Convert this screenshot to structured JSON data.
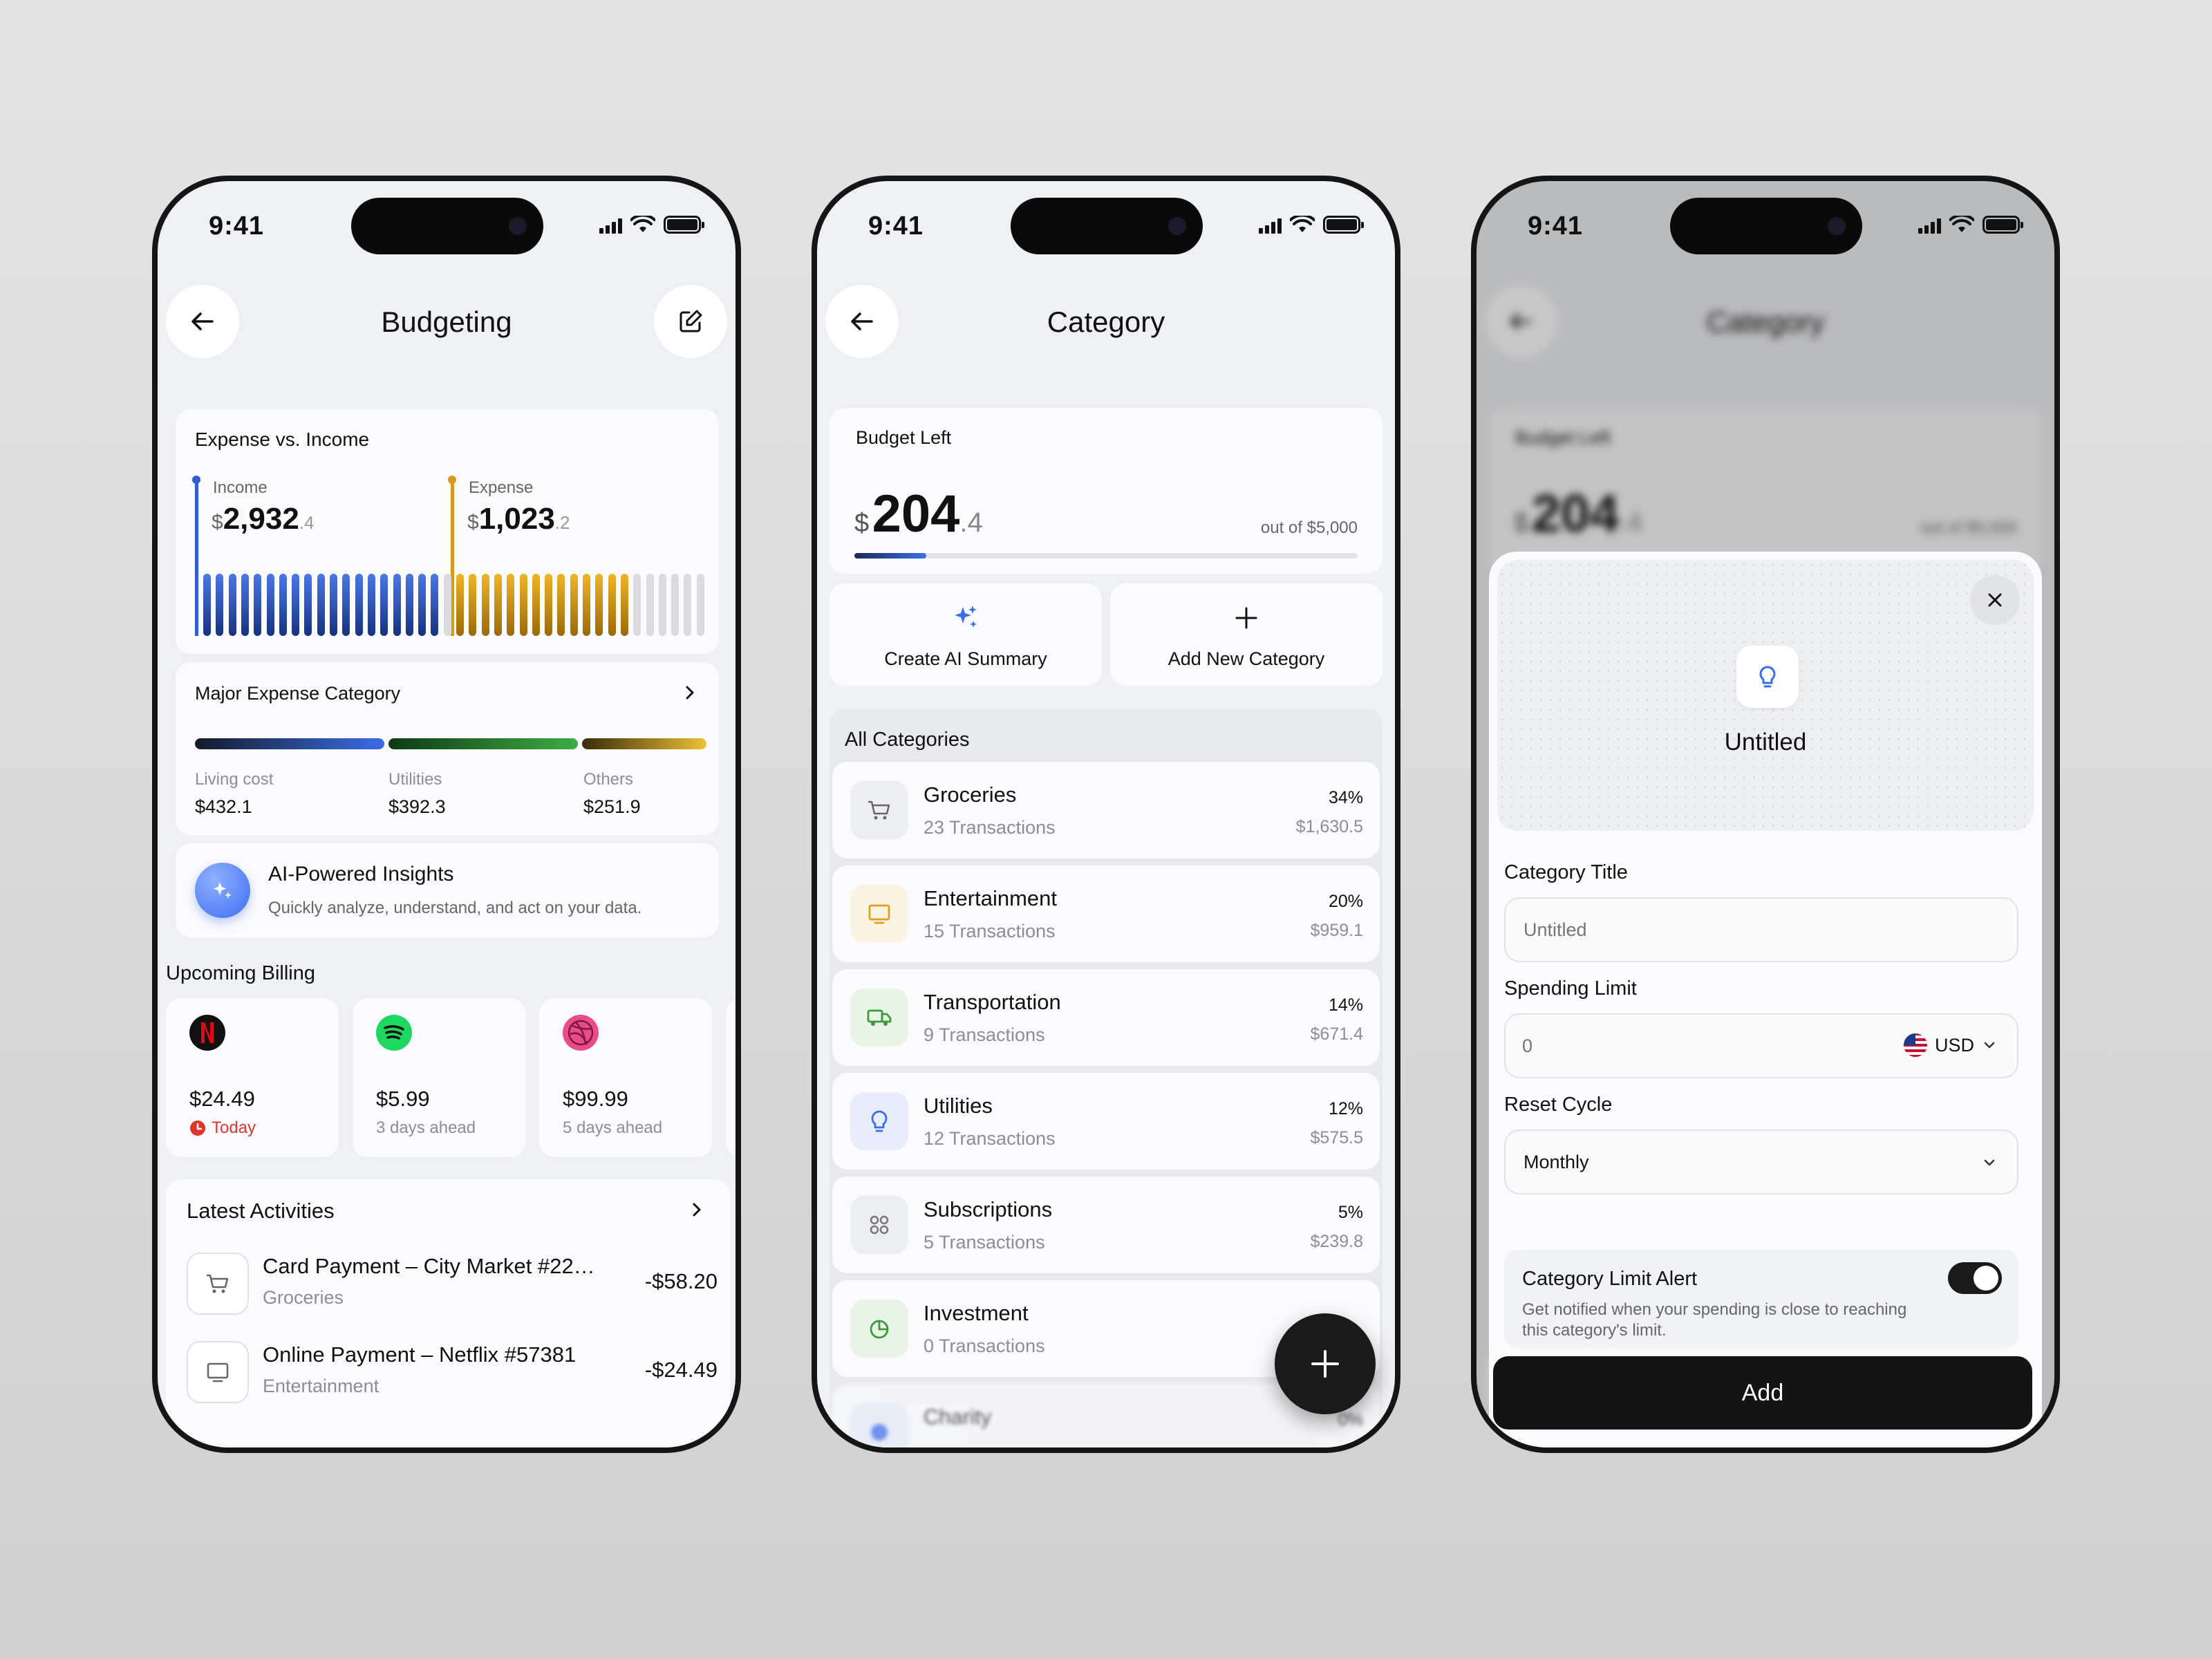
{
  "status_time": "9:41",
  "budgeting": {
    "title": "Budgeting",
    "expense_income": {
      "title": "Expense vs. Income",
      "income_label": "Income",
      "income_currency": "$",
      "income_value": "2,932",
      "income_decimal": ".4",
      "expense_label": "Expense",
      "expense_currency": "$",
      "expense_value": "1,023",
      "expense_decimal": ".2"
    },
    "major": {
      "title": "Major Expense Category",
      "items": [
        {
          "label": "Living cost",
          "value": "$432.1"
        },
        {
          "label": "Utilities",
          "value": "$392.3"
        },
        {
          "label": "Others",
          "value": "$251.9"
        }
      ]
    },
    "ai": {
      "title": "AI-Powered Insights",
      "desc": "Quickly analyze, understand, and act on your data."
    },
    "upcoming": {
      "title": "Upcoming Billing",
      "items": [
        {
          "amount": "$24.49",
          "when": "Today"
        },
        {
          "amount": "$5.99",
          "when": "3 days ahead"
        },
        {
          "amount": "$99.99",
          "when": "5 days ahead"
        }
      ]
    },
    "activities": {
      "title": "Latest Activities",
      "items": [
        {
          "title": "Card Payment – City Market #22…",
          "category": "Groceries",
          "amount": "-$58.20"
        },
        {
          "title": "Online Payment – Netflix #57381",
          "category": "Entertainment",
          "amount": "-$24.49"
        }
      ]
    }
  },
  "category": {
    "title": "Category",
    "budget": {
      "label": "Budget Left",
      "currency": "$",
      "value": "204",
      "decimal": ".4",
      "out_of": "out of $5,000",
      "progress": 0.041
    },
    "actions": {
      "ai": "Create AI Summary",
      "add": "Add New Category"
    },
    "all_label": "All Categories",
    "items": [
      {
        "name": "Groceries",
        "tx": "23 Transactions",
        "pct": "34%",
        "amount": "$1,630.5",
        "icon": "cart-icon"
      },
      {
        "name": "Entertainment",
        "tx": "15 Transactions",
        "pct": "20%",
        "amount": "$959.1",
        "icon": "monitor-icon"
      },
      {
        "name": "Transportation",
        "tx": "9 Transactions",
        "pct": "14%",
        "amount": "$671.4",
        "icon": "truck-icon"
      },
      {
        "name": "Utilities",
        "tx": "12 Transactions",
        "pct": "12%",
        "amount": "$575.5",
        "icon": "bulb-icon"
      },
      {
        "name": "Subscriptions",
        "tx": "5 Transactions",
        "pct": "5%",
        "amount": "$239.8",
        "icon": "grid-icon"
      },
      {
        "name": "Investment",
        "tx": "0 Transactions",
        "pct": "",
        "amount": "",
        "icon": "pie-icon"
      },
      {
        "name": "Charity",
        "tx": "",
        "pct": "0%",
        "amount": "",
        "icon": "charity-icon"
      }
    ]
  },
  "sheet": {
    "preview_name": "Untitled",
    "title_label": "Category Title",
    "title_placeholder": "Untitled",
    "limit_label": "Spending Limit",
    "limit_placeholder": "0",
    "currency": "USD",
    "cycle_label": "Reset Cycle",
    "cycle_value": "Monthly",
    "alert_title": "Category Limit Alert",
    "alert_desc": "Get notified when your spending is close to reaching this category's limit.",
    "alert_on": true,
    "add_button": "Add"
  },
  "colors": {
    "income": "#2f5fd0",
    "expense": "#d49a1a",
    "living": "#3a6ee8",
    "utilities": "#2d9a3a",
    "others": "#e0b530",
    "today": "#e0352b"
  }
}
